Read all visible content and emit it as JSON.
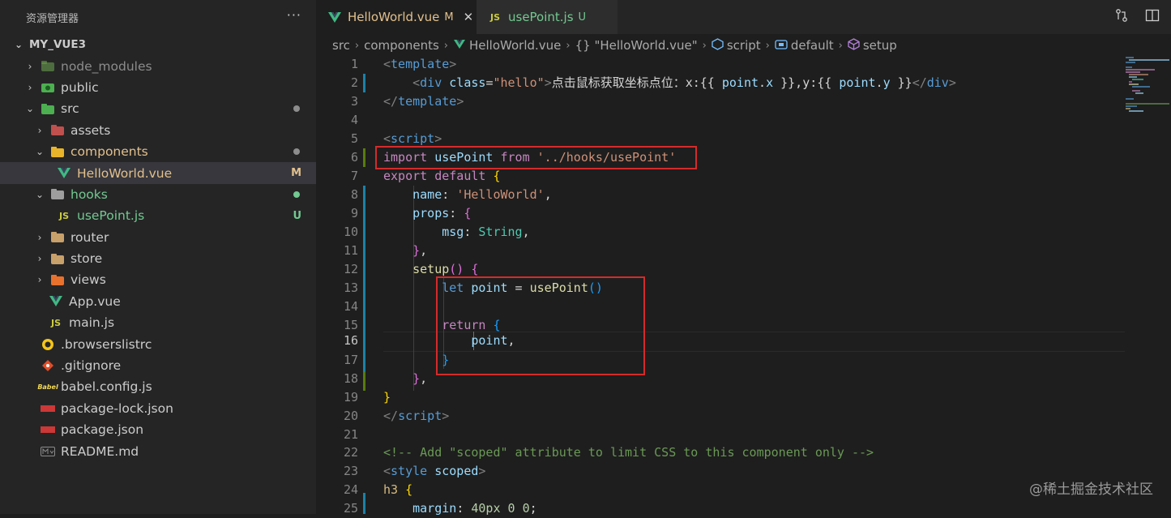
{
  "sidebar": {
    "title": "资源管理器",
    "more": "···",
    "project": "MY_VUE3",
    "items": [
      {
        "label": "node_modules",
        "status": ""
      },
      {
        "label": "public",
        "status": ""
      },
      {
        "label": "src",
        "status": ""
      },
      {
        "label": "assets",
        "status": ""
      },
      {
        "label": "components",
        "status": ""
      },
      {
        "label": "HelloWorld.vue",
        "status": "M"
      },
      {
        "label": "hooks",
        "status": ""
      },
      {
        "label": "usePoint.js",
        "status": "U"
      },
      {
        "label": "router",
        "status": ""
      },
      {
        "label": "store",
        "status": ""
      },
      {
        "label": "views",
        "status": ""
      },
      {
        "label": "App.vue",
        "status": ""
      },
      {
        "label": "main.js",
        "status": ""
      },
      {
        "label": ".browserslistrc",
        "status": ""
      },
      {
        "label": ".gitignore",
        "status": ""
      },
      {
        "label": "babel.config.js",
        "status": ""
      },
      {
        "label": "package-lock.json",
        "status": ""
      },
      {
        "label": "package.json",
        "status": ""
      },
      {
        "label": "README.md",
        "status": ""
      }
    ]
  },
  "tabs": [
    {
      "label": "HelloWorld.vue",
      "status": "M",
      "icon": "V"
    },
    {
      "label": "usePoint.js",
      "status": "U",
      "icon": "JS"
    }
  ],
  "breadcrumb": [
    "src",
    "components",
    "HelloWorld.vue",
    "{} \"HelloWorld.vue\"",
    "script",
    "default",
    "setup"
  ],
  "editor": {
    "line_numbers": [
      "1",
      "2",
      "3",
      "4",
      "5",
      "6",
      "7",
      "8",
      "9",
      "10",
      "11",
      "12",
      "13",
      "14",
      "15",
      "16",
      "17",
      "18",
      "19",
      "20",
      "21",
      "22",
      "23",
      "24",
      "25"
    ],
    "active_line": "16",
    "code": {
      "l1": [
        "<",
        "template",
        ">"
      ],
      "l2": [
        "<",
        "div",
        " ",
        "class",
        "=",
        "\"hello\"",
        ">",
        "点击鼠标获取坐标点位：x:{{ ",
        "point",
        ".",
        "x",
        " }},y:{{ ",
        "point",
        ".",
        "y",
        " }}",
        "</",
        "div",
        ">"
      ],
      "l3": [
        "</",
        "template",
        ">"
      ],
      "l5": [
        "<",
        "script",
        ">"
      ],
      "l6": [
        "import",
        " ",
        "usePoint",
        " ",
        "from",
        " ",
        "'../hooks/usePoint'"
      ],
      "l7": [
        "export",
        " ",
        "default",
        " ",
        "{"
      ],
      "l8": [
        "name",
        ": ",
        "'HelloWorld'",
        ","
      ],
      "l9": [
        "props",
        ": ",
        "{"
      ],
      "l10": [
        "msg",
        ": ",
        "String",
        ","
      ],
      "l11": [
        "}",
        ","
      ],
      "l12": [
        "setup",
        "()",
        " ",
        "{"
      ],
      "l13": [
        "let",
        " ",
        "point",
        " = ",
        "usePoint",
        "()"
      ],
      "l15": [
        "return",
        " ",
        "{"
      ],
      "l16": [
        "point",
        ","
      ],
      "l17": [
        "}"
      ],
      "l18": [
        "}",
        ","
      ],
      "l19": [
        "}"
      ],
      "l20": [
        "</",
        "script",
        ">"
      ],
      "l22": [
        "<!-- Add \"scoped\" attribute to limit CSS to this component only -->"
      ],
      "l23": [
        "<",
        "style",
        " ",
        "scoped",
        ">"
      ],
      "l24": [
        "h3",
        " ",
        "{"
      ],
      "l25": [
        "margin",
        ": ",
        "40px",
        " ",
        "0",
        " ",
        "0",
        ";"
      ]
    }
  },
  "watermark": "@稀土掘金技术社区",
  "colors": {
    "modified": "#e2c08d",
    "untracked": "#73c991",
    "highlight_box": "#d42b2b",
    "vue": "#41b883",
    "js": "#cbcb41"
  }
}
